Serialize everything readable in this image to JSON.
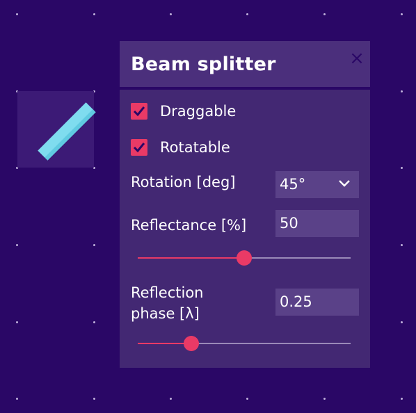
{
  "panel": {
    "title": "Beam splitter",
    "close_label": "×"
  },
  "draggable": {
    "label": "Draggable",
    "checked": true
  },
  "rotatable": {
    "label": "Rotatable",
    "checked": true
  },
  "rotation": {
    "label": "Rotation [deg]",
    "value": "45°"
  },
  "reflectance": {
    "label": "Reflectance [%]",
    "value": "50",
    "slider_fraction": 0.5
  },
  "phase": {
    "label_line1": "Reflection",
    "label_line2": "phase [λ]",
    "value": "0.25",
    "slider_fraction": 0.25
  },
  "colors": {
    "background": "#2a0766",
    "panel": "#432873",
    "accent": "#e93a66",
    "element": "#7fdcef"
  },
  "icons": [
    "beam-splitter-icon",
    "close-icon",
    "check-icon",
    "chevron-down-icon"
  ]
}
